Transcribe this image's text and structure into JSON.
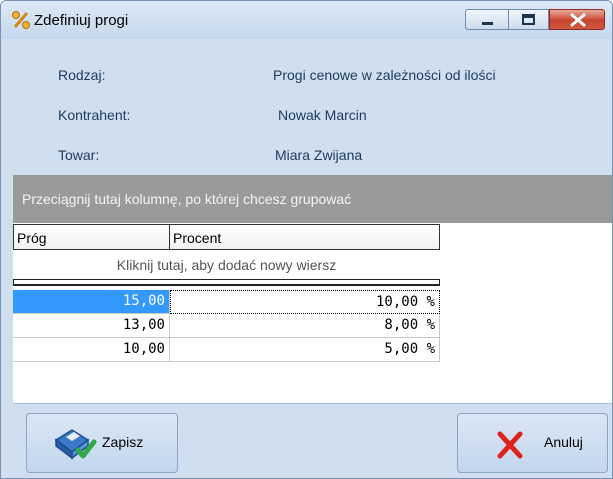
{
  "window": {
    "title": "Zdefiniuj progi",
    "icon": "percent-icon"
  },
  "window_controls": [
    "minimize-icon",
    "maximize-icon",
    "close-icon"
  ],
  "info": {
    "type_label": "Rodzaj:",
    "type_value": "Progi cenowe  w zależności od ilości",
    "contractor_label": "Kontrahent:",
    "contractor_value": "Nowak Marcin",
    "product_label": "Towar:",
    "product_value": "Miara Zwijana"
  },
  "grid": {
    "group_hint": "Przeciągnij tutaj kolumnę, po której chcesz grupować",
    "columns": [
      "Próg",
      "Procent"
    ],
    "new_row_hint": "Kliknij tutaj, aby dodać nowy wiersz",
    "rows": [
      {
        "threshold": "15,00",
        "percent": "10,00 %"
      },
      {
        "threshold": "13,00",
        "percent": "8,00 %"
      },
      {
        "threshold": "10,00",
        "percent": "5,00 %"
      }
    ]
  },
  "buttons": {
    "save_label": "Zapisz",
    "cancel_label": "Anuluj"
  },
  "colors": {
    "selection": "#3399ff",
    "group_panel": "#9a9a9a",
    "window_bg": "#cfdfef"
  }
}
